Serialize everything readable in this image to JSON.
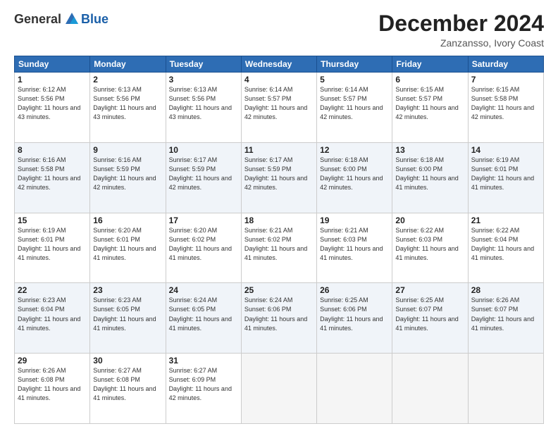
{
  "header": {
    "logo": {
      "general": "General",
      "blue": "Blue"
    },
    "title": "December 2024",
    "subtitle": "Zanzansso, Ivory Coast"
  },
  "days_of_week": [
    "Sunday",
    "Monday",
    "Tuesday",
    "Wednesday",
    "Thursday",
    "Friday",
    "Saturday"
  ],
  "weeks": [
    [
      {
        "day": "1",
        "sunrise": "6:12 AM",
        "sunset": "5:56 PM",
        "daylight": "11 hours and 43 minutes."
      },
      {
        "day": "2",
        "sunrise": "6:13 AM",
        "sunset": "5:56 PM",
        "daylight": "11 hours and 43 minutes."
      },
      {
        "day": "3",
        "sunrise": "6:13 AM",
        "sunset": "5:56 PM",
        "daylight": "11 hours and 43 minutes."
      },
      {
        "day": "4",
        "sunrise": "6:14 AM",
        "sunset": "5:57 PM",
        "daylight": "11 hours and 42 minutes."
      },
      {
        "day": "5",
        "sunrise": "6:14 AM",
        "sunset": "5:57 PM",
        "daylight": "11 hours and 42 minutes."
      },
      {
        "day": "6",
        "sunrise": "6:15 AM",
        "sunset": "5:57 PM",
        "daylight": "11 hours and 42 minutes."
      },
      {
        "day": "7",
        "sunrise": "6:15 AM",
        "sunset": "5:58 PM",
        "daylight": "11 hours and 42 minutes."
      }
    ],
    [
      {
        "day": "8",
        "sunrise": "6:16 AM",
        "sunset": "5:58 PM",
        "daylight": "11 hours and 42 minutes."
      },
      {
        "day": "9",
        "sunrise": "6:16 AM",
        "sunset": "5:59 PM",
        "daylight": "11 hours and 42 minutes."
      },
      {
        "day": "10",
        "sunrise": "6:17 AM",
        "sunset": "5:59 PM",
        "daylight": "11 hours and 42 minutes."
      },
      {
        "day": "11",
        "sunrise": "6:17 AM",
        "sunset": "5:59 PM",
        "daylight": "11 hours and 42 minutes."
      },
      {
        "day": "12",
        "sunrise": "6:18 AM",
        "sunset": "6:00 PM",
        "daylight": "11 hours and 42 minutes."
      },
      {
        "day": "13",
        "sunrise": "6:18 AM",
        "sunset": "6:00 PM",
        "daylight": "11 hours and 41 minutes."
      },
      {
        "day": "14",
        "sunrise": "6:19 AM",
        "sunset": "6:01 PM",
        "daylight": "11 hours and 41 minutes."
      }
    ],
    [
      {
        "day": "15",
        "sunrise": "6:19 AM",
        "sunset": "6:01 PM",
        "daylight": "11 hours and 41 minutes."
      },
      {
        "day": "16",
        "sunrise": "6:20 AM",
        "sunset": "6:01 PM",
        "daylight": "11 hours and 41 minutes."
      },
      {
        "day": "17",
        "sunrise": "6:20 AM",
        "sunset": "6:02 PM",
        "daylight": "11 hours and 41 minutes."
      },
      {
        "day": "18",
        "sunrise": "6:21 AM",
        "sunset": "6:02 PM",
        "daylight": "11 hours and 41 minutes."
      },
      {
        "day": "19",
        "sunrise": "6:21 AM",
        "sunset": "6:03 PM",
        "daylight": "11 hours and 41 minutes."
      },
      {
        "day": "20",
        "sunrise": "6:22 AM",
        "sunset": "6:03 PM",
        "daylight": "11 hours and 41 minutes."
      },
      {
        "day": "21",
        "sunrise": "6:22 AM",
        "sunset": "6:04 PM",
        "daylight": "11 hours and 41 minutes."
      }
    ],
    [
      {
        "day": "22",
        "sunrise": "6:23 AM",
        "sunset": "6:04 PM",
        "daylight": "11 hours and 41 minutes."
      },
      {
        "day": "23",
        "sunrise": "6:23 AM",
        "sunset": "6:05 PM",
        "daylight": "11 hours and 41 minutes."
      },
      {
        "day": "24",
        "sunrise": "6:24 AM",
        "sunset": "6:05 PM",
        "daylight": "11 hours and 41 minutes."
      },
      {
        "day": "25",
        "sunrise": "6:24 AM",
        "sunset": "6:06 PM",
        "daylight": "11 hours and 41 minutes."
      },
      {
        "day": "26",
        "sunrise": "6:25 AM",
        "sunset": "6:06 PM",
        "daylight": "11 hours and 41 minutes."
      },
      {
        "day": "27",
        "sunrise": "6:25 AM",
        "sunset": "6:07 PM",
        "daylight": "11 hours and 41 minutes."
      },
      {
        "day": "28",
        "sunrise": "6:26 AM",
        "sunset": "6:07 PM",
        "daylight": "11 hours and 41 minutes."
      }
    ],
    [
      {
        "day": "29",
        "sunrise": "6:26 AM",
        "sunset": "6:08 PM",
        "daylight": "11 hours and 41 minutes."
      },
      {
        "day": "30",
        "sunrise": "6:27 AM",
        "sunset": "6:08 PM",
        "daylight": "11 hours and 41 minutes."
      },
      {
        "day": "31",
        "sunrise": "6:27 AM",
        "sunset": "6:09 PM",
        "daylight": "11 hours and 42 minutes."
      },
      null,
      null,
      null,
      null
    ]
  ]
}
